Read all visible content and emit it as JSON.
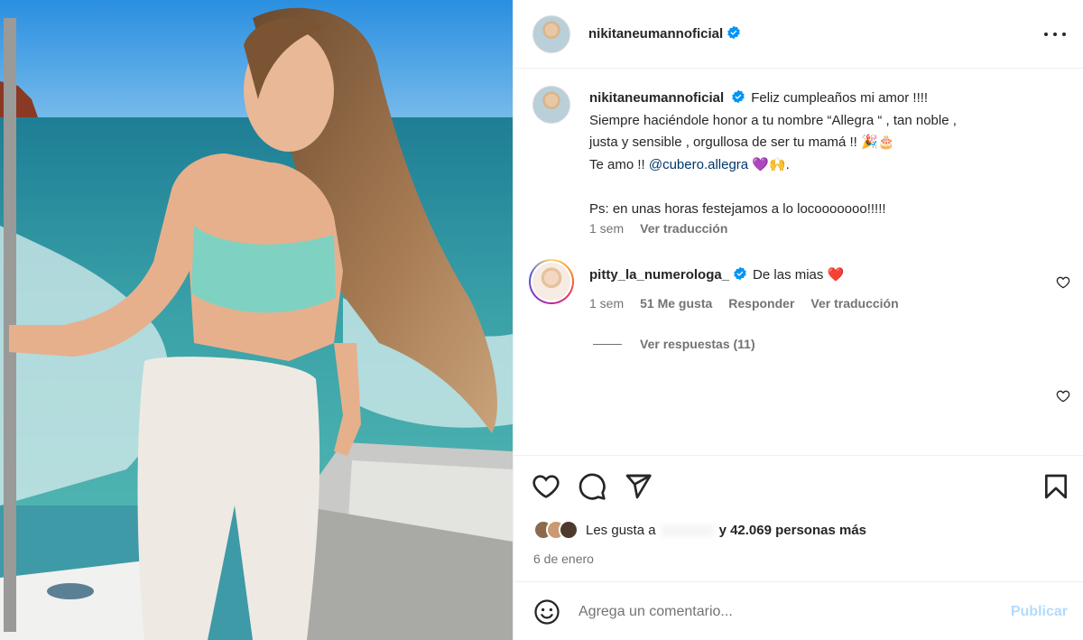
{
  "post": {
    "owner": "nikitaneumannoficial"
  },
  "caption": {
    "username": "nikitaneumannoficial",
    "line1": "Feliz cumpleaños mi amor !!!!",
    "line2": "Siempre haciéndole honor a tu nombre “Allegra “ , tan noble ,",
    "line3": "justa y sensible , orgullosa de ser tu mamá !! 🎉🎂",
    "line4_prefix": "Te amo !! ",
    "mention": "@cubero.allegra",
    "line4_suffix": " 💜🙌.",
    "line5": "Ps: en unas horas festejamos a lo locooooooo!!!!!",
    "time": "1 sem",
    "translate": "Ver traducción"
  },
  "comments": [
    {
      "username": "pitty_la_numerologa_",
      "text": "De las mias ❤️",
      "time": "1 sem",
      "likes": "51 Me gusta",
      "reply": "Responder",
      "translate": "Ver traducción",
      "view_replies": "Ver respuestas (11)"
    }
  ],
  "likes": {
    "prefix": "Les gusta a",
    "suffix": "y 42.069 personas más"
  },
  "date": "6 de enero",
  "comment_box": {
    "placeholder": "Agrega un comentario...",
    "publish": "Publicar"
  },
  "icons": {
    "verified": "verified-badge-icon",
    "more": "more-options-icon",
    "like": "heart-icon",
    "comment": "comment-icon",
    "share": "share-icon",
    "save": "bookmark-icon",
    "emoji": "emoji-icon"
  },
  "colors": {
    "verified": "#0095f6",
    "mention": "#00376b",
    "secondary_text": "#737373",
    "publish_disabled": "#b3dbff",
    "heart_red": "#ed4956"
  }
}
